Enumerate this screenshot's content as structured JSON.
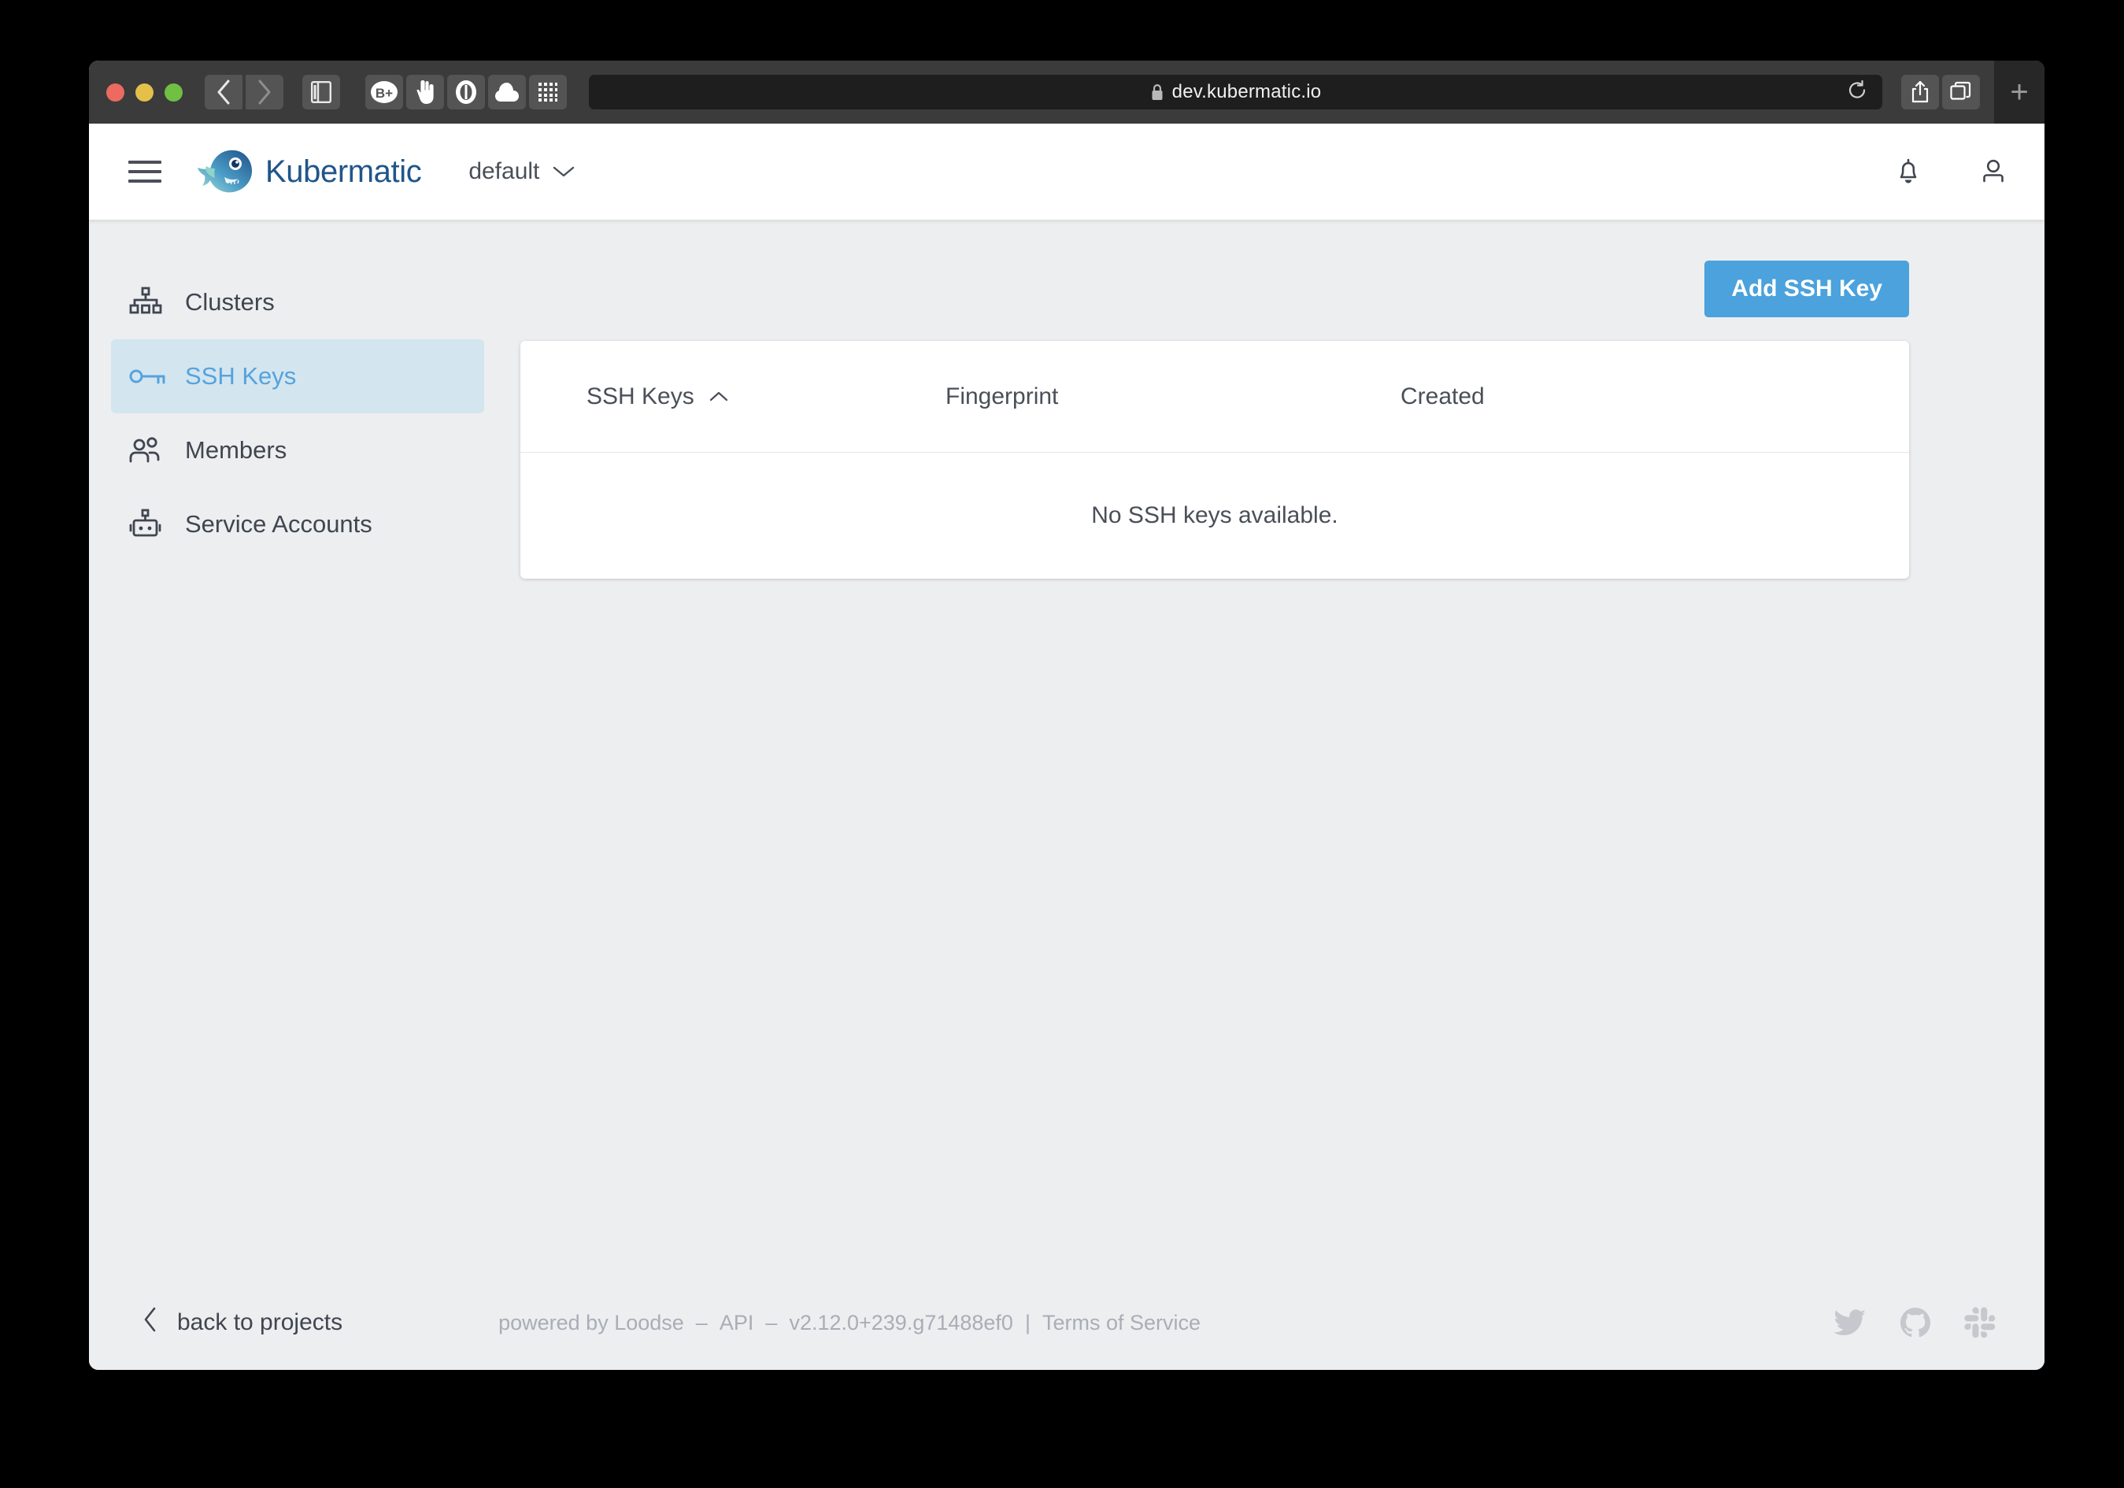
{
  "browser": {
    "url": "dev.kubermatic.io",
    "lock_icon": "lock-icon",
    "reload_icon": "reload-icon",
    "traffic_lights": [
      "close",
      "minimize",
      "zoom"
    ],
    "toolbar_buttons": [
      {
        "name": "back-button",
        "glyph": "‹"
      },
      {
        "name": "forward-button",
        "glyph": "›"
      },
      {
        "name": "sidebar-toggle-button",
        "glyph": "sidebar-icon"
      },
      {
        "name": "bitwarden-extension-button",
        "glyph": "B+"
      },
      {
        "name": "ublock-extension-button",
        "glyph": "hand-icon"
      },
      {
        "name": "onepassword-extension-button",
        "glyph": "onepassword-icon"
      },
      {
        "name": "cloud-extension-button",
        "glyph": "cloud-icon"
      },
      {
        "name": "apps-grid-button",
        "glyph": "grid-icon"
      }
    ],
    "share_button": "share-icon",
    "tab-overview_button": "tab-overview-icon",
    "new_tab_label": "+"
  },
  "header": {
    "menu_icon": "hamburger-icon",
    "logo_icon": "kubermatic-fish-logo",
    "brand": "Kubermatic",
    "project": "default",
    "project_chevron": "chevron-down-icon",
    "notifications_icon": "bell-icon",
    "account_icon": "user-icon"
  },
  "sidebar": {
    "items": [
      {
        "label": "Clusters",
        "icon": "clusters-icon",
        "active": false
      },
      {
        "label": "SSH Keys",
        "icon": "key-icon",
        "active": true
      },
      {
        "label": "Members",
        "icon": "members-icon",
        "active": false
      },
      {
        "label": "Service Accounts",
        "icon": "robot-icon",
        "active": false
      }
    ]
  },
  "content": {
    "add_button_label": "Add SSH Key",
    "table": {
      "columns": [
        "SSH Keys",
        "Fingerprint",
        "Created"
      ],
      "sort_column": "SSH Keys",
      "sort_icon": "chevron-up-icon",
      "rows": [],
      "empty_message": "No SSH keys available."
    }
  },
  "footer": {
    "back_icon": "chevron-left-icon",
    "back_label": "back to projects",
    "powered_by": "powered by Loodse",
    "dash1": "–",
    "api_label": "API",
    "dash2": "–",
    "version": "v2.12.0+239.g71488ef0",
    "pipe": "|",
    "terms_label": "Terms of Service",
    "social": [
      {
        "name": "twitter-icon"
      },
      {
        "name": "github-icon"
      },
      {
        "name": "slack-icon"
      }
    ]
  },
  "colors": {
    "accent_blue": "#4ba2dc",
    "active_nav_bg": "#d3e5ef",
    "active_nav_text": "#55a3dd",
    "brand_text": "#20558a",
    "page_bg": "#edeef0",
    "text_primary": "#4a4f58",
    "muted_text": "#a8aeb6"
  }
}
